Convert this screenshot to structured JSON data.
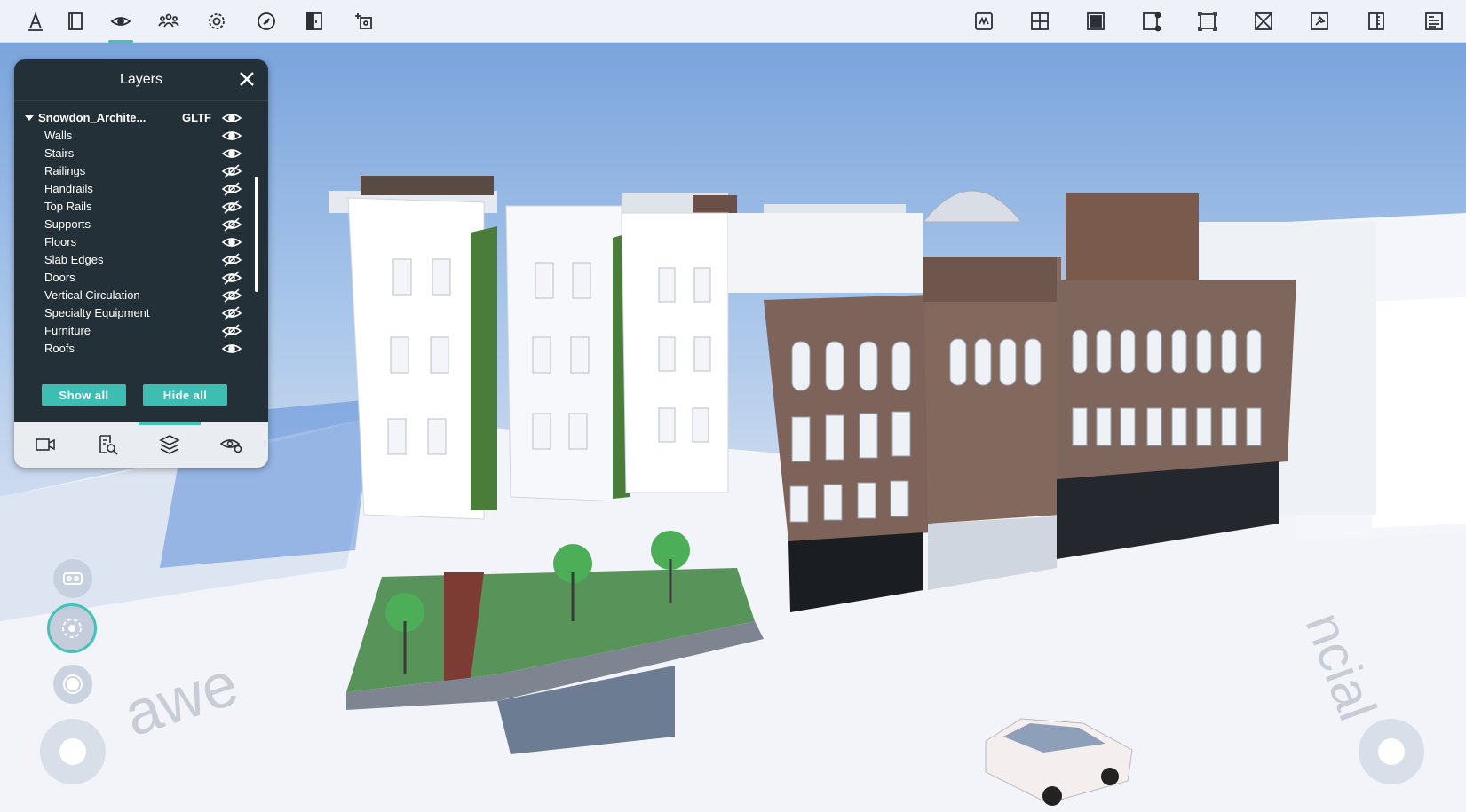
{
  "toolbar": {
    "left_icons": [
      "measure-icon",
      "section-box-icon",
      "visibility-icon",
      "people-icon",
      "settings-icon",
      "compass-icon",
      "split-view-icon",
      "focus-icon"
    ],
    "right_icons": [
      "markup-icon",
      "grid-icon",
      "solid-fill-icon",
      "crop-icon",
      "fit-frame-icon",
      "close-box-icon",
      "pin-icon",
      "ruler-icon",
      "document-icon"
    ],
    "active": "visibility-icon"
  },
  "panel": {
    "title": "Layers",
    "root": {
      "label": "Snowdon_Archite...",
      "type": "GLTF",
      "visible": true
    },
    "layers": [
      {
        "label": "Walls",
        "visible": true
      },
      {
        "label": "Stairs",
        "visible": true
      },
      {
        "label": "Railings",
        "visible": false
      },
      {
        "label": "Handrails",
        "visible": false
      },
      {
        "label": "Top Rails",
        "visible": false
      },
      {
        "label": "Supports",
        "visible": false
      },
      {
        "label": "Floors",
        "visible": true
      },
      {
        "label": "Slab Edges",
        "visible": false
      },
      {
        "label": "Doors",
        "visible": false
      },
      {
        "label": "Vertical Circulation",
        "visible": false
      },
      {
        "label": "Specialty Equipment",
        "visible": false
      },
      {
        "label": "Furniture",
        "visible": false
      },
      {
        "label": "Roofs",
        "visible": true
      }
    ],
    "show_all": "Show all",
    "hide_all": "Hide all",
    "tabs": [
      "camera-icon",
      "search-document-icon",
      "layers-icon",
      "visibility-settings-icon"
    ],
    "active_tab": "layers-icon"
  },
  "colors": {
    "accent": "#43c2b6",
    "panel_bg": "#243037",
    "toolbar_bg": "#eef2f8"
  }
}
